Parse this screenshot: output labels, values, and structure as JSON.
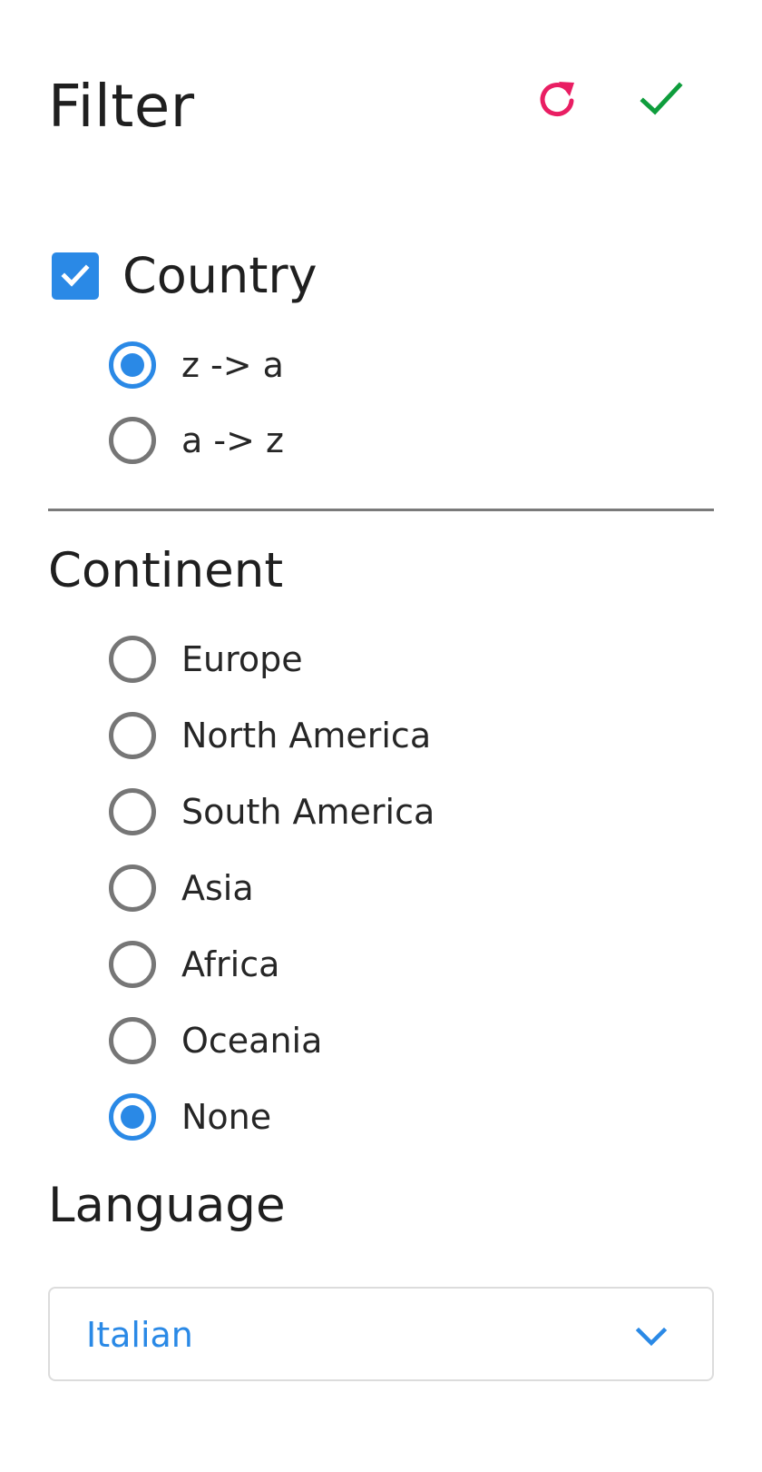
{
  "header": {
    "title": "Filter",
    "reset_icon": "refresh-icon",
    "apply_icon": "check-icon",
    "reset_color": "#e91e63",
    "apply_color": "#0e9d3c"
  },
  "country": {
    "label": "Country",
    "checked": true,
    "sort_options": [
      {
        "label": "z -> a",
        "selected": true
      },
      {
        "label": "a -> z",
        "selected": false
      }
    ]
  },
  "continent": {
    "title": "Continent",
    "options": [
      {
        "label": "Europe",
        "selected": false
      },
      {
        "label": "North America",
        "selected": false
      },
      {
        "label": "South America",
        "selected": false
      },
      {
        "label": "Asia",
        "selected": false
      },
      {
        "label": "Africa",
        "selected": false
      },
      {
        "label": "Oceania",
        "selected": false
      },
      {
        "label": "None",
        "selected": true
      }
    ]
  },
  "language": {
    "title": "Language",
    "selected_value": "Italian",
    "chevron_icon": "chevron-down-icon"
  },
  "colors": {
    "accent": "#2a89e6",
    "radio_border": "#767676",
    "divider": "#7a7a7a"
  }
}
